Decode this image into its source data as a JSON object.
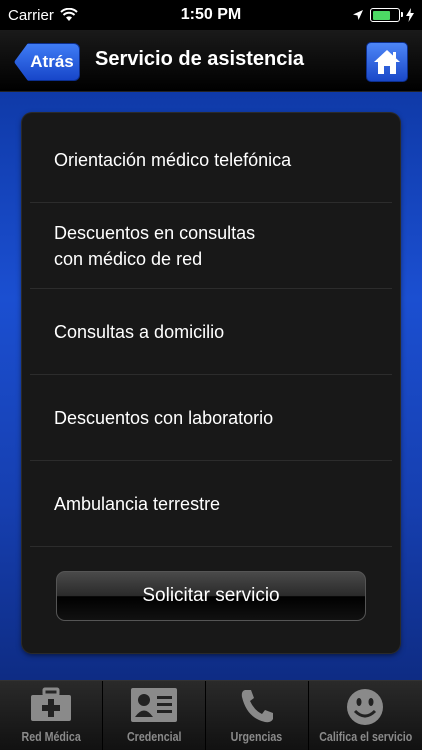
{
  "status_bar": {
    "carrier": "Carrier",
    "time": "1:50 PM",
    "battery_level": 0.7,
    "icons": [
      "wifi-icon",
      "location-icon",
      "battery-icon",
      "charging-icon"
    ]
  },
  "nav": {
    "back_label": "Atrás",
    "title": "Servicio de asistencia",
    "home_icon": "home-icon"
  },
  "menu": {
    "items": [
      {
        "label": "Orientación médico telefónica"
      },
      {
        "label": "Descuentos en consultas\ncon médico de red"
      },
      {
        "label": "Consultas a domicilio"
      },
      {
        "label": "Descuentos con laboratorio"
      },
      {
        "label": "Ambulancia terrestre"
      }
    ],
    "action_label": "Solicitar servicio"
  },
  "tabs": [
    {
      "label": "Red Médica",
      "icon": "medical-kit-icon"
    },
    {
      "label": "Credencial",
      "icon": "id-card-icon"
    },
    {
      "label": "Urgencias",
      "icon": "phone-icon"
    },
    {
      "label": "Califica el servicio",
      "icon": "smiley-icon"
    }
  ],
  "colors": {
    "accent_blue": "#1b4fd1",
    "battery_green": "#4cd964",
    "tab_label": "#8a8a8a"
  }
}
